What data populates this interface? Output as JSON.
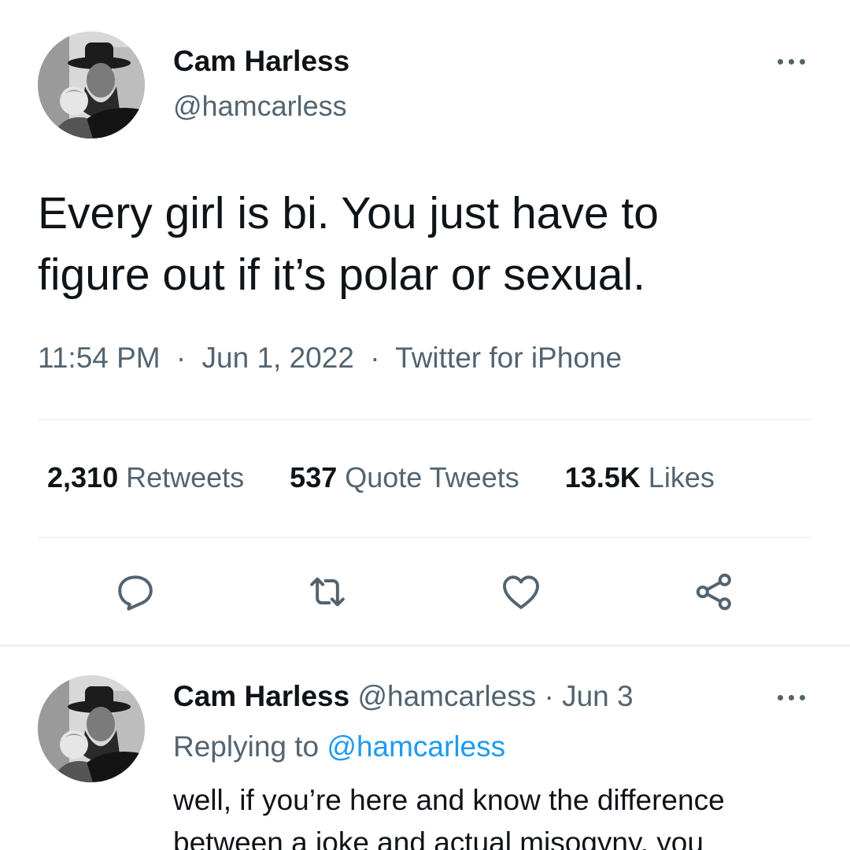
{
  "tweet": {
    "author_name": "Cam Harless",
    "author_handle": "@hamcarless",
    "text_lines": [
      "Every girl is bi. You just have to",
      "figure out if it’s polar or sexual."
    ],
    "time": "11:54 PM",
    "date": "Jun 1, 2022",
    "source": "Twitter for iPhone",
    "meta_separator": "·",
    "stats": {
      "retweets_count": "2,310",
      "retweets_label": "Retweets",
      "quotes_count": "537",
      "quotes_label": "Quote Tweets",
      "likes_count": "13.5K",
      "likes_label": "Likes"
    },
    "actions": [
      "reply-icon",
      "retweet-icon",
      "heart-icon",
      "share-icon"
    ]
  },
  "reply": {
    "author_name": "Cam Harless",
    "author_handle": "@hamcarless",
    "separator": "·",
    "date": "Jun 3",
    "replying_prefix": "Replying to",
    "replying_handle": "@hamcarless",
    "text_lines": [
      "well, if you’re here and know the difference",
      "between a joke and actual misogyny, you"
    ]
  },
  "colors": {
    "text_primary": "#0f1419",
    "text_secondary": "#536471",
    "link": "#1d9bf0",
    "divider": "#eff3f4"
  }
}
